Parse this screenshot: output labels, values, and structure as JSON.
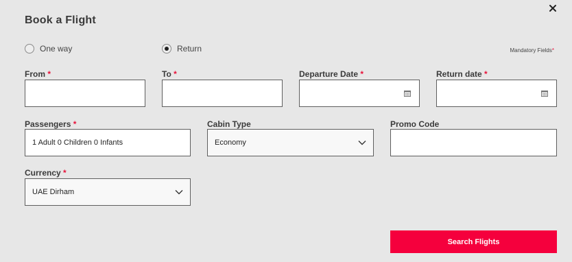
{
  "dialog": {
    "title": "Book a Flight",
    "mandatory_text": "Mandatory Fields",
    "required_mark": "*"
  },
  "trip_type": {
    "options": [
      {
        "label": "One way",
        "checked": false
      },
      {
        "label": "Return",
        "checked": true
      }
    ]
  },
  "fields": {
    "from": {
      "label": "From",
      "value": "",
      "required": true
    },
    "to": {
      "label": "To",
      "value": "",
      "required": true
    },
    "departure_date": {
      "label": "Departure Date",
      "value": "",
      "required": true
    },
    "return_date": {
      "label": "Return date",
      "value": "",
      "required": true
    },
    "passengers": {
      "label": "Passengers",
      "value": "1 Adult 0 Children 0 Infants",
      "required": true
    },
    "cabin_type": {
      "label": "Cabin Type",
      "value": "Economy",
      "required": false
    },
    "promo_code": {
      "label": "Promo Code",
      "value": "",
      "required": false
    },
    "currency": {
      "label": "Currency",
      "value": "UAE Dirham",
      "required": true
    }
  },
  "search_button": {
    "label": "Search Flights"
  },
  "colors": {
    "accent": "#f5003d",
    "required": "#e8123a",
    "background": "#e7e7e7"
  },
  "icons": {
    "close": "close-icon",
    "calendar": "calendar-icon",
    "chevron": "chevron-down-icon"
  }
}
